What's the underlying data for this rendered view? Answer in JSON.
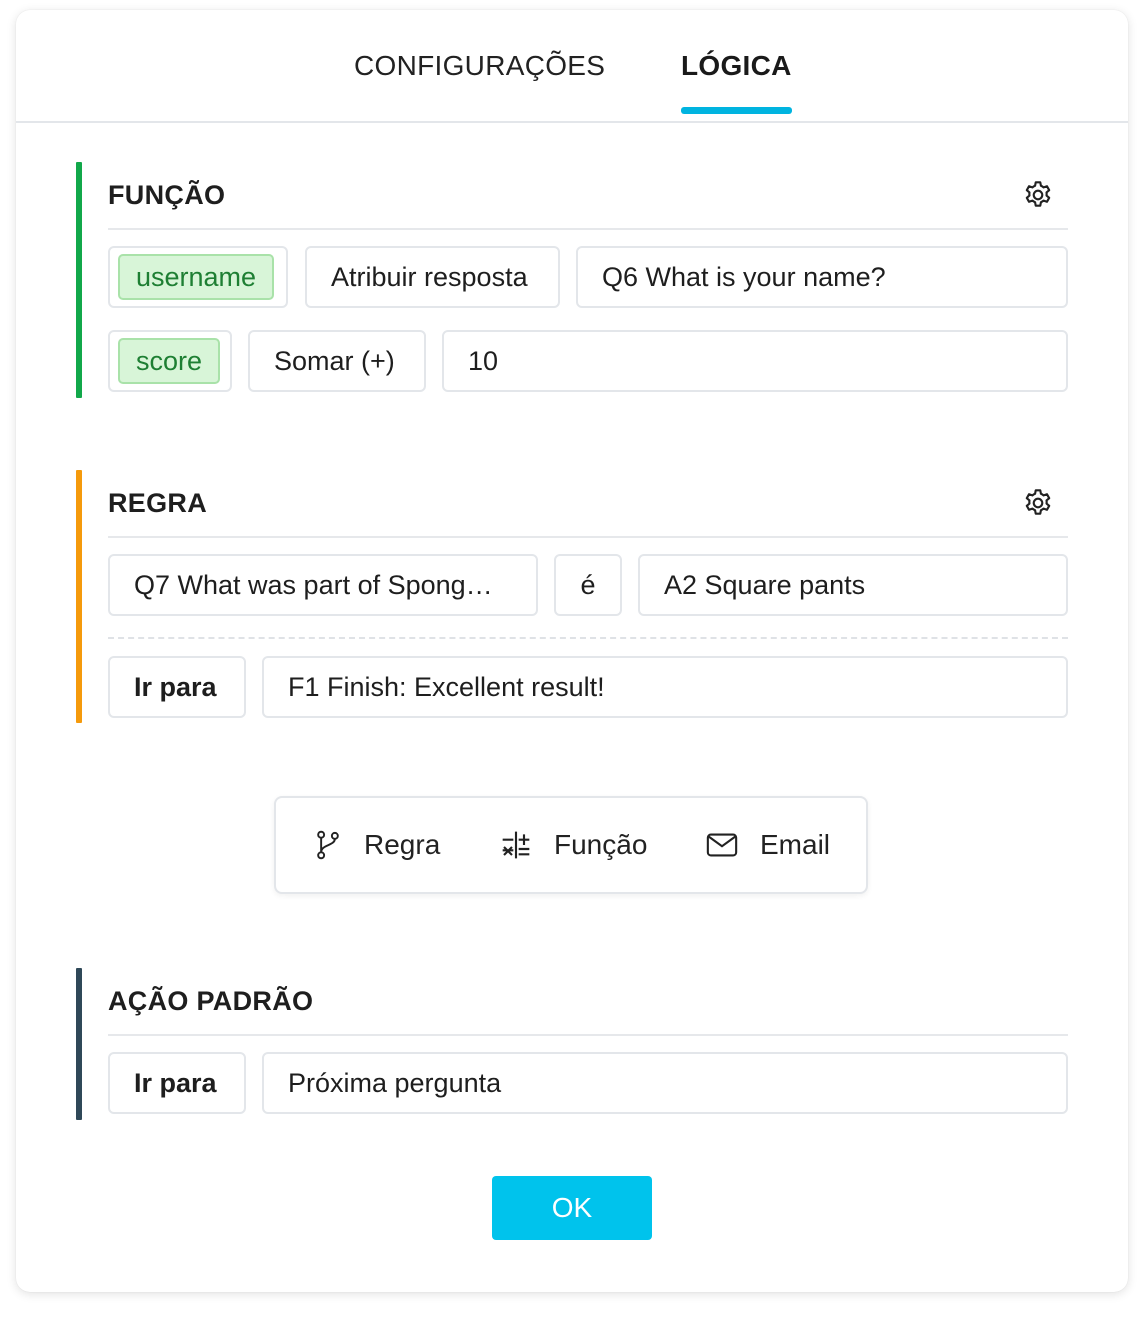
{
  "tabs": {
    "settings": "CONFIGURAÇÕES",
    "logic": "LÓGICA"
  },
  "function_section": {
    "title": "FUNÇÃO",
    "rows": [
      {
        "variable": "username",
        "operation": "Atribuir resposta",
        "value": "Q6 What is your name?"
      },
      {
        "variable": "score",
        "operation": "Somar (+)",
        "value": "10"
      }
    ]
  },
  "rule_section": {
    "title": "REGRA",
    "condition": {
      "question": "Q7 What was part of Spong…",
      "operator": "é",
      "answer": "A2 Square pants"
    },
    "action": {
      "label": "Ir para",
      "target": "F1 Finish: Excellent result!"
    }
  },
  "add_bar": {
    "rule": "Regra",
    "function": "Função",
    "email": "Email"
  },
  "default_section": {
    "title": "AÇÃO PADRÃO",
    "action": {
      "label": "Ir para",
      "target": "Próxima pergunta"
    }
  },
  "ok_label": "OK",
  "colors": {
    "accent": "#00b4e0",
    "function_bar": "#11a84a",
    "rule_bar": "#f59a0c",
    "default_bar": "#2f4858",
    "variable_bg": "#d8f5d8",
    "ok_button": "#00c3ec"
  }
}
